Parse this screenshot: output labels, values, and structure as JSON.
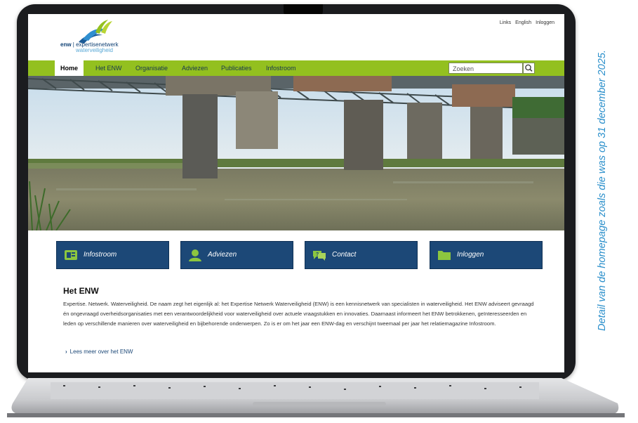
{
  "top_links": [
    "Links",
    "English",
    "Inloggen"
  ],
  "logo": {
    "prefix": "enw",
    "line1": "expertisenetwerk",
    "line2": "waterveiligheid"
  },
  "nav": {
    "items": [
      "Home",
      "Het ENW",
      "Organisatie",
      "Adviezen",
      "Publicaties",
      "Infostroom"
    ],
    "active": "Home"
  },
  "search": {
    "placeholder": "Zoeken",
    "icon": "search-icon"
  },
  "tiles": [
    {
      "label": "Infostroom",
      "icon": "newspaper-icon"
    },
    {
      "label": "Adviezen",
      "icon": "person-icon"
    },
    {
      "label": "Contact",
      "icon": "chat-question-icon"
    },
    {
      "label": "Inloggen",
      "icon": "folder-icon"
    }
  ],
  "section": {
    "title": "Het ENW",
    "body": "Expertise. Netwerk. Waterveiligheid. De naam zegt het eigenlijk al: het Expertise Netwerk Waterveiligheid (ENW) is een kennisnetwerk van specialisten in waterveiligheid. Het ENW adviseert gevraagd én ongevraagd overheidsorganisaties met een verantwoordelijkheid voor waterveiligheid over actuele vraagstukken en innovaties. Daarnaast informeert het ENW betrokkenen, geïnteresseerden en leden op verschillende manieren over waterveiligheid en bijbehorende onderwerpen. Zo is er om het jaar een ENW-dag en verschijnt tweemaal per jaar het relatiemagazine Infostroom.",
    "read_more": "Lees meer over het ENW"
  },
  "caption": "Detail van de homepage zoals die was op 31 december 2025.",
  "colors": {
    "nav_green": "#93c01f",
    "tile_blue": "#1c4877",
    "caption_blue": "#2a8fcb",
    "tile_icon_green": "#8cc63f"
  }
}
